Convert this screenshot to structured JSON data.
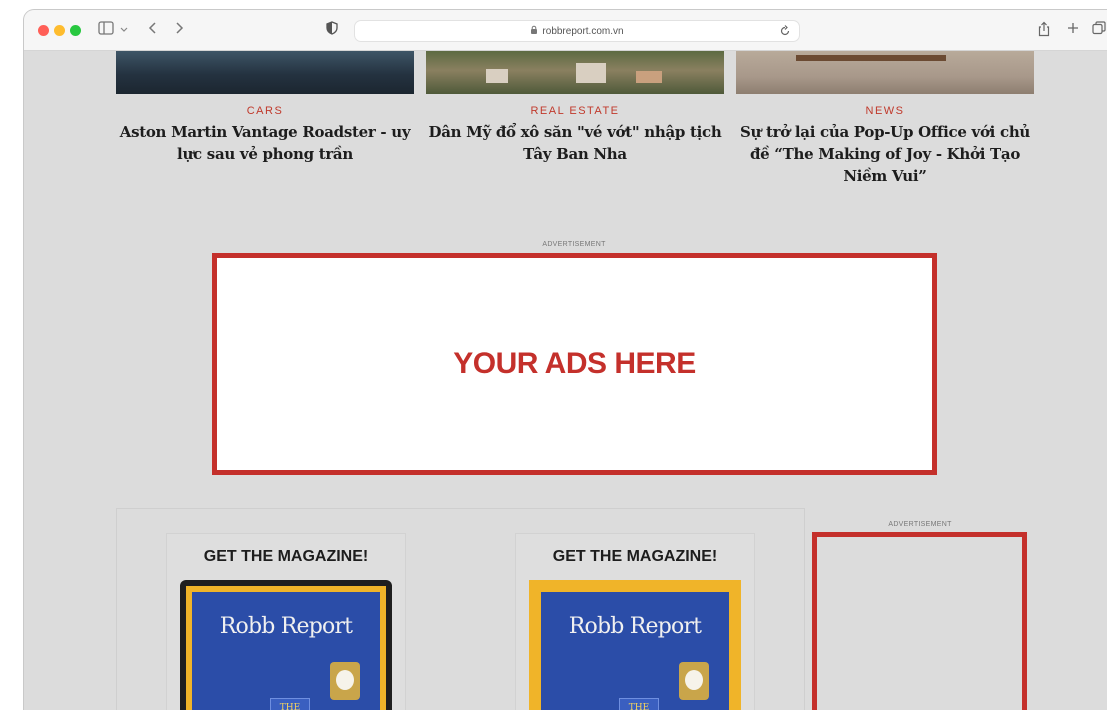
{
  "browser": {
    "url": "robbreport.com.vn"
  },
  "articles": [
    {
      "category": "CARS",
      "title": "Aston Martin Vantage Roadster - uy lực sau vẻ phong trần"
    },
    {
      "category": "REAL ESTATE",
      "title": "Dân Mỹ đổ xô săn \"vé vớt\" nhập tịch Tây Ban Nha"
    },
    {
      "category": "NEWS",
      "title": "Sự trở lại của Pop-Up Office với chủ đề “The Making of Joy - Khởi Tạo Niềm Vui”"
    }
  ],
  "ads": {
    "label": "ADVERTISEMENT",
    "banner_text": "YOUR ADS HERE",
    "side_label": "ADVERTISEMENT"
  },
  "magazine": {
    "cards": [
      {
        "title": "GET THE MAGAZINE!",
        "brand": "Robb Report",
        "cover_word": "THE"
      },
      {
        "title": "GET THE MAGAZINE!",
        "brand": "Robb Report",
        "cover_word": "THE"
      }
    ]
  },
  "colors": {
    "accent": "#c4302b",
    "category": "#c0392b",
    "page_bg": "#dcdcdc",
    "cover_blue": "#2b4da8",
    "cover_yellow": "#f0b429"
  },
  "icons": [
    "sidebar-icon",
    "chevron-down-icon",
    "back-icon",
    "forward-icon",
    "shield-icon",
    "lock-icon",
    "reload-icon",
    "share-icon",
    "new-tab-icon",
    "tabs-icon"
  ]
}
